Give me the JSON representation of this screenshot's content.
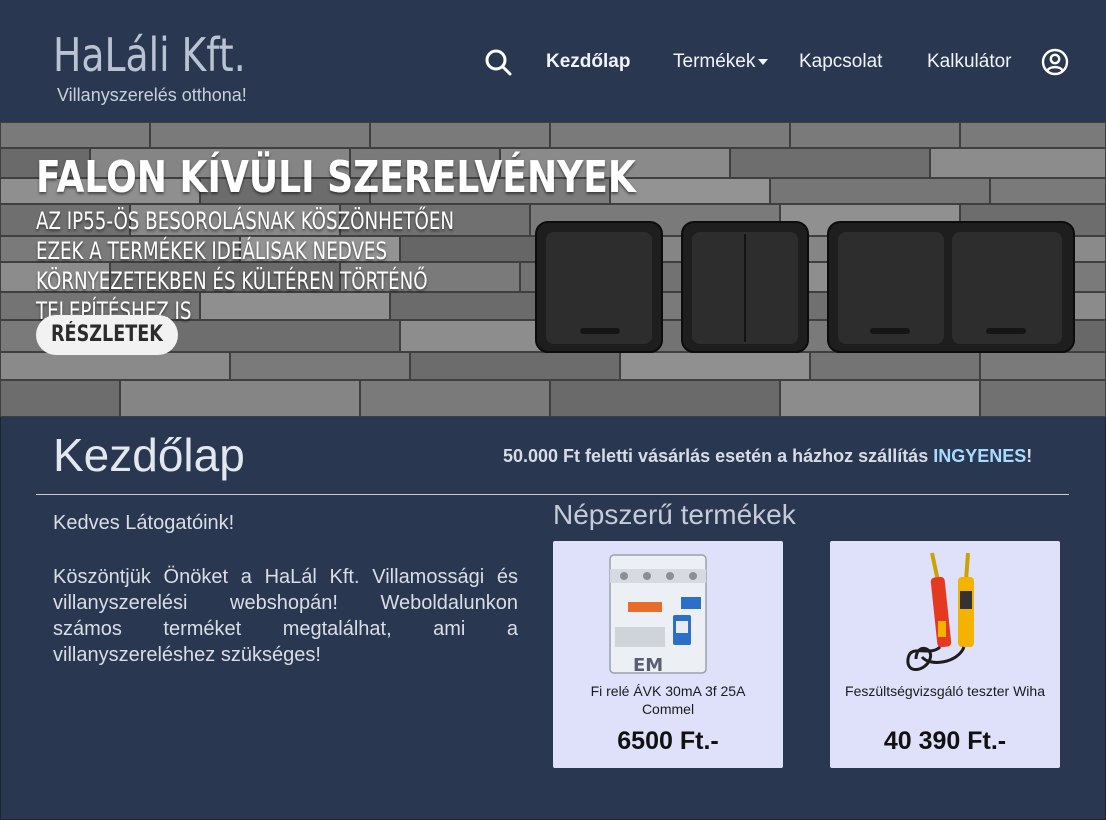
{
  "header": {
    "logo_title": "HaLáli Kft.",
    "logo_subtitle": "Villanyszerelés otthona!",
    "nav": {
      "home": "Kezdőlap",
      "products": "Termékek",
      "contact": "Kapcsolat",
      "calculator": "Kalkulátor"
    }
  },
  "banner": {
    "title": "FALON KÍVÜLI SZERELVÉNYEK",
    "text": "AZ IP55-ÖS BESOROLÁSNAK KÖSZÖNHETŐEN EZEK A TERMÉKEK IDEÁLISAK NEDVES KÖRNYEZETEKBEN ÉS KÜLTÉREN TÖRTÉNŐ TELEPÍTÉSHEZ IS",
    "button": "RÉSZLETEK"
  },
  "main": {
    "title": "Kezdőlap",
    "shipping_text": "50.000 Ft feletti vásárlás esetén a házhoz szállítás ",
    "shipping_highlight": "INGYENES",
    "shipping_end": "!",
    "greeting": "Kedves Látogatóink!",
    "welcome": "Köszöntjük Önöket a HaLál Kft. Villamossági és villanyszerelési webshopán! Weboldalunkon számos terméket megtalálhat, ami a villanyszereléshez szükséges!"
  },
  "popular": {
    "title": "Népszerű termékek",
    "products": [
      {
        "name": "Fi relé ÁVK 30mA 3f 25A Commel",
        "price": "6500 Ft.-"
      },
      {
        "name": "Feszültségvizsgáló teszter Wiha",
        "price": "40 390 Ft.-"
      }
    ]
  },
  "icons": {
    "search": "search-icon",
    "user": "user-icon",
    "dropdown": "caret-down-icon"
  },
  "colors": {
    "background": "#2a3750",
    "card": "#dfe1fb",
    "highlight": "#a7dbff"
  }
}
